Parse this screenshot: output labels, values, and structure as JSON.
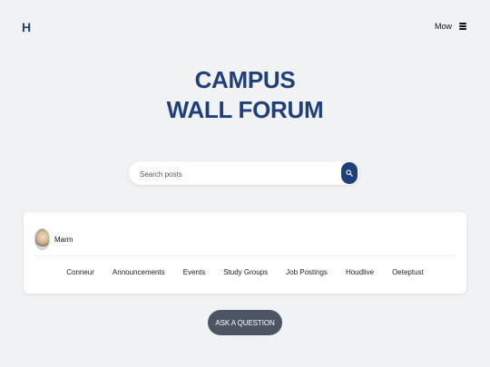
{
  "header": {
    "logo_text": "H",
    "user_name": "Mow",
    "menu_icon": "hamburger-menu-icon"
  },
  "hero": {
    "title_line1": "CAMPUS",
    "title_line2": "WALL FORUM"
  },
  "search": {
    "placeholder": "Search posts",
    "value": "",
    "button_icon": "search-icon"
  },
  "card": {
    "user_name": "Marm",
    "categories": [
      {
        "label": "Conneur"
      },
      {
        "label": "Announcements"
      },
      {
        "label": "Events"
      },
      {
        "label": "Study Groups"
      },
      {
        "label": "Job Postings"
      },
      {
        "label": "Houdlive"
      },
      {
        "label": "Oeteptust"
      }
    ]
  },
  "actions": {
    "ask_label": "ASK A QUESTION"
  },
  "colors": {
    "brand": "#1e3f7a",
    "background": "#f1f2f4",
    "card": "#ffffff",
    "button_dark": "#4c5562"
  }
}
